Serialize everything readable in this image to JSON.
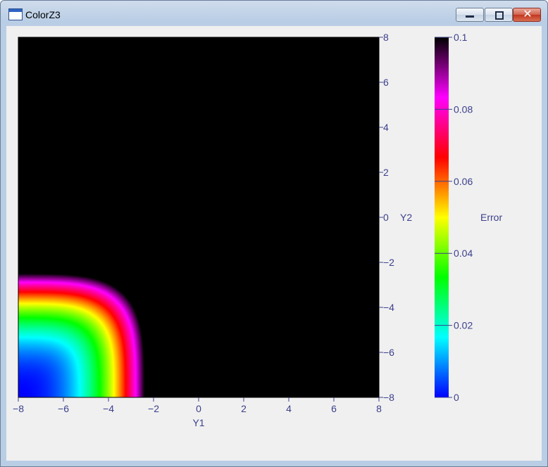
{
  "window": {
    "title": "ColorZ3",
    "minimize_glyph": "minimize-icon",
    "maximize_glyph": "restore-icon",
    "close_glyph": "close-icon",
    "close_char": "✕"
  },
  "chart_data": {
    "type": "heatmap",
    "title": "",
    "xlabel": "Y1",
    "ylabel": "Y2",
    "colorbar_label": "Error",
    "xlim": [
      -8,
      8
    ],
    "ylim": [
      -8,
      8
    ],
    "zlim": [
      0,
      0.1
    ],
    "x_ticks": [
      -8,
      -6,
      -4,
      -2,
      0,
      2,
      4,
      6,
      8
    ],
    "x_tick_labels": [
      "−8",
      "−6",
      "−4",
      "−2",
      "0",
      "2",
      "4",
      "6",
      "8"
    ],
    "y_ticks": [
      8,
      6,
      4,
      2,
      0,
      -2,
      -4,
      -6,
      -8
    ],
    "y_tick_labels": [
      "8",
      "6",
      "4",
      "2",
      "0",
      "−2",
      "−4",
      "−6",
      "−8"
    ],
    "colorbar_ticks": [
      0.1,
      0.08,
      0.06,
      0.04,
      0.02,
      0
    ],
    "colorbar_tick_labels": [
      "0.1",
      "0.08",
      "0.06",
      "0.04",
      "0.02",
      "0"
    ],
    "colormap": [
      "#0000ff",
      "#00ffff",
      "#00ff00",
      "#ffff00",
      "#ff0000",
      "#ff00ff",
      "#000000"
    ],
    "saturation_color": "#000000",
    "grid": false,
    "colorbar_position": "right",
    "field": {
      "description_formula": "error = 0.1 * 2^(max(0, y1 + 8.2) / 2.85)^2 * 2^(max(0, y2 + 8.2) / 2.85)^2 - 0.1 (saturates above 0.1)",
      "corner_value_at_min": 0,
      "contour_0_1_y1_at_bottom": -2.4,
      "contour_0_1_y2_at_left": -2.5
    }
  }
}
